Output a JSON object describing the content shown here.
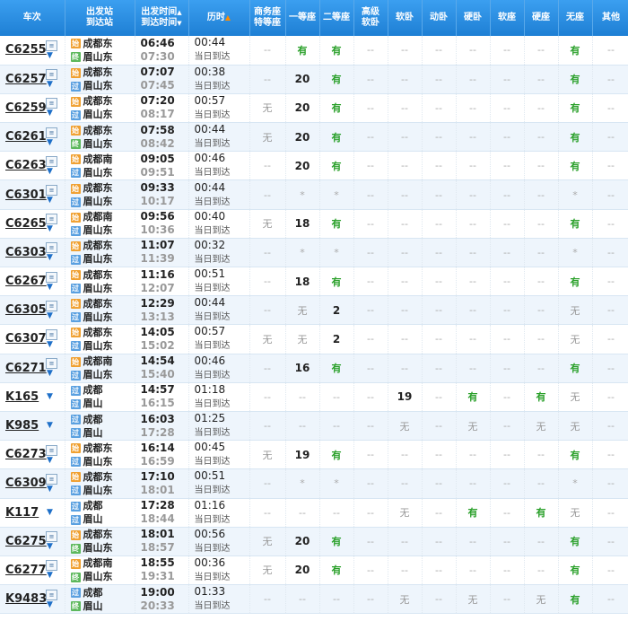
{
  "headers": {
    "train": "车次",
    "stations_top": "出发站",
    "stations_bottom": "到达站",
    "times_top": "出发时间",
    "times_bottom": "到达时间",
    "duration": "历时",
    "biz_top": "商务座",
    "biz_bottom": "特等座",
    "first": "一等座",
    "second": "二等座",
    "adv_top": "高级",
    "adv_bottom": "软卧",
    "soft_sleeper": "软卧",
    "moving": "动卧",
    "hard_sleeper": "硬卧",
    "soft_seat": "软座",
    "hard_seat": "硬座",
    "no_seat": "无座",
    "other": "其他"
  },
  "sort_asc_glyph": "▲",
  "sort_desc_glyph": "▼",
  "dropdown_glyph": "▼",
  "icon_glyph": "≡",
  "badge_start": "始",
  "badge_pass": "过",
  "badge_end": "终",
  "rows": [
    {
      "train": "C6255",
      "has_icon": true,
      "from": "成都东",
      "to": "眉山东",
      "from_type": "start",
      "to_type": "end",
      "dep": "06:46",
      "arr": "07:30",
      "dur": "00:44",
      "day": "当日到达",
      "seats": [
        "--",
        "有",
        "有",
        "--",
        "--",
        "--",
        "--",
        "--",
        "--",
        "有",
        "--"
      ]
    },
    {
      "train": "C6257",
      "has_icon": true,
      "from": "成都东",
      "to": "眉山东",
      "from_type": "start",
      "to_type": "pass",
      "dep": "07:07",
      "arr": "07:45",
      "dur": "00:38",
      "day": "当日到达",
      "seats": [
        "--",
        "20",
        "有",
        "--",
        "--",
        "--",
        "--",
        "--",
        "--",
        "有",
        "--"
      ]
    },
    {
      "train": "C6259",
      "has_icon": true,
      "from": "成都东",
      "to": "眉山东",
      "from_type": "start",
      "to_type": "pass",
      "dep": "07:20",
      "arr": "08:17",
      "dur": "00:57",
      "day": "当日到达",
      "seats": [
        "无",
        "20",
        "有",
        "--",
        "--",
        "--",
        "--",
        "--",
        "--",
        "有",
        "--"
      ]
    },
    {
      "train": "C6261",
      "has_icon": true,
      "from": "成都东",
      "to": "眉山东",
      "from_type": "start",
      "to_type": "end",
      "dep": "07:58",
      "arr": "08:42",
      "dur": "00:44",
      "day": "当日到达",
      "seats": [
        "无",
        "20",
        "有",
        "--",
        "--",
        "--",
        "--",
        "--",
        "--",
        "有",
        "--"
      ]
    },
    {
      "train": "C6263",
      "has_icon": true,
      "from": "成都南",
      "to": "眉山东",
      "from_type": "start",
      "to_type": "pass",
      "dep": "09:05",
      "arr": "09:51",
      "dur": "00:46",
      "day": "当日到达",
      "seats": [
        "--",
        "20",
        "有",
        "--",
        "--",
        "--",
        "--",
        "--",
        "--",
        "有",
        "--"
      ]
    },
    {
      "train": "C6301",
      "has_icon": true,
      "from": "成都东",
      "to": "眉山东",
      "from_type": "start",
      "to_type": "pass",
      "dep": "09:33",
      "arr": "10:17",
      "dur": "00:44",
      "day": "当日到达",
      "seats": [
        "--",
        "*",
        "*",
        "--",
        "--",
        "--",
        "--",
        "--",
        "--",
        "*",
        "--"
      ]
    },
    {
      "train": "C6265",
      "has_icon": true,
      "from": "成都南",
      "to": "眉山东",
      "from_type": "start",
      "to_type": "pass",
      "dep": "09:56",
      "arr": "10:36",
      "dur": "00:40",
      "day": "当日到达",
      "seats": [
        "无",
        "18",
        "有",
        "--",
        "--",
        "--",
        "--",
        "--",
        "--",
        "有",
        "--"
      ]
    },
    {
      "train": "C6303",
      "has_icon": true,
      "from": "成都东",
      "to": "眉山东",
      "from_type": "start",
      "to_type": "pass",
      "dep": "11:07",
      "arr": "11:39",
      "dur": "00:32",
      "day": "当日到达",
      "seats": [
        "--",
        "*",
        "*",
        "--",
        "--",
        "--",
        "--",
        "--",
        "--",
        "*",
        "--"
      ]
    },
    {
      "train": "C6267",
      "has_icon": true,
      "from": "成都东",
      "to": "眉山东",
      "from_type": "start",
      "to_type": "pass",
      "dep": "11:16",
      "arr": "12:07",
      "dur": "00:51",
      "day": "当日到达",
      "seats": [
        "--",
        "18",
        "有",
        "--",
        "--",
        "--",
        "--",
        "--",
        "--",
        "有",
        "--"
      ]
    },
    {
      "train": "C6305",
      "has_icon": true,
      "from": "成都东",
      "to": "眉山东",
      "from_type": "start",
      "to_type": "pass",
      "dep": "12:29",
      "arr": "13:13",
      "dur": "00:44",
      "day": "当日到达",
      "seats": [
        "--",
        "无",
        "2",
        "--",
        "--",
        "--",
        "--",
        "--",
        "--",
        "无",
        "--"
      ]
    },
    {
      "train": "C6307",
      "has_icon": true,
      "from": "成都东",
      "to": "眉山东",
      "from_type": "start",
      "to_type": "pass",
      "dep": "14:05",
      "arr": "15:02",
      "dur": "00:57",
      "day": "当日到达",
      "seats": [
        "无",
        "无",
        "2",
        "--",
        "--",
        "--",
        "--",
        "--",
        "--",
        "无",
        "--"
      ]
    },
    {
      "train": "C6271",
      "has_icon": true,
      "from": "成都南",
      "to": "眉山东",
      "from_type": "start",
      "to_type": "pass",
      "dep": "14:54",
      "arr": "15:40",
      "dur": "00:46",
      "day": "当日到达",
      "seats": [
        "--",
        "16",
        "有",
        "--",
        "--",
        "--",
        "--",
        "--",
        "--",
        "有",
        "--"
      ]
    },
    {
      "train": "K165",
      "has_icon": false,
      "from": "成都",
      "to": "眉山",
      "from_type": "pass",
      "to_type": "pass",
      "dep": "14:57",
      "arr": "16:15",
      "dur": "01:18",
      "day": "当日到达",
      "seats": [
        "--",
        "--",
        "--",
        "--",
        "19",
        "--",
        "有",
        "--",
        "有",
        "无",
        "--"
      ]
    },
    {
      "train": "K985",
      "has_icon": false,
      "from": "成都",
      "to": "眉山",
      "from_type": "pass",
      "to_type": "pass",
      "dep": "16:03",
      "arr": "17:28",
      "dur": "01:25",
      "day": "当日到达",
      "seats": [
        "--",
        "--",
        "--",
        "--",
        "无",
        "--",
        "无",
        "--",
        "无",
        "无",
        "--"
      ]
    },
    {
      "train": "C6273",
      "has_icon": true,
      "from": "成都东",
      "to": "眉山东",
      "from_type": "start",
      "to_type": "pass",
      "dep": "16:14",
      "arr": "16:59",
      "dur": "00:45",
      "day": "当日到达",
      "seats": [
        "无",
        "19",
        "有",
        "--",
        "--",
        "--",
        "--",
        "--",
        "--",
        "有",
        "--"
      ]
    },
    {
      "train": "C6309",
      "has_icon": true,
      "from": "成都东",
      "to": "眉山东",
      "from_type": "start",
      "to_type": "pass",
      "dep": "17:10",
      "arr": "18:01",
      "dur": "00:51",
      "day": "当日到达",
      "seats": [
        "--",
        "*",
        "*",
        "--",
        "--",
        "--",
        "--",
        "--",
        "--",
        "*",
        "--"
      ]
    },
    {
      "train": "K117",
      "has_icon": false,
      "from": "成都",
      "to": "眉山",
      "from_type": "pass",
      "to_type": "pass",
      "dep": "17:28",
      "arr": "18:44",
      "dur": "01:16",
      "day": "当日到达",
      "seats": [
        "--",
        "--",
        "--",
        "--",
        "无",
        "--",
        "有",
        "--",
        "有",
        "无",
        "--"
      ]
    },
    {
      "train": "C6275",
      "has_icon": true,
      "from": "成都东",
      "to": "眉山东",
      "from_type": "start",
      "to_type": "end",
      "dep": "18:01",
      "arr": "18:57",
      "dur": "00:56",
      "day": "当日到达",
      "seats": [
        "无",
        "20",
        "有",
        "--",
        "--",
        "--",
        "--",
        "--",
        "--",
        "有",
        "--"
      ]
    },
    {
      "train": "C6277",
      "has_icon": true,
      "from": "成都南",
      "to": "眉山东",
      "from_type": "start",
      "to_type": "end",
      "dep": "18:55",
      "arr": "19:31",
      "dur": "00:36",
      "day": "当日到达",
      "seats": [
        "无",
        "20",
        "有",
        "--",
        "--",
        "--",
        "--",
        "--",
        "--",
        "有",
        "--"
      ]
    },
    {
      "train": "K9483",
      "has_icon": true,
      "from": "成都",
      "to": "眉山",
      "from_type": "pass",
      "to_type": "end",
      "dep": "19:00",
      "arr": "20:33",
      "dur": "01:33",
      "day": "当日到达",
      "seats": [
        "--",
        "--",
        "--",
        "--",
        "无",
        "--",
        "无",
        "--",
        "无",
        "有",
        "--"
      ]
    }
  ]
}
